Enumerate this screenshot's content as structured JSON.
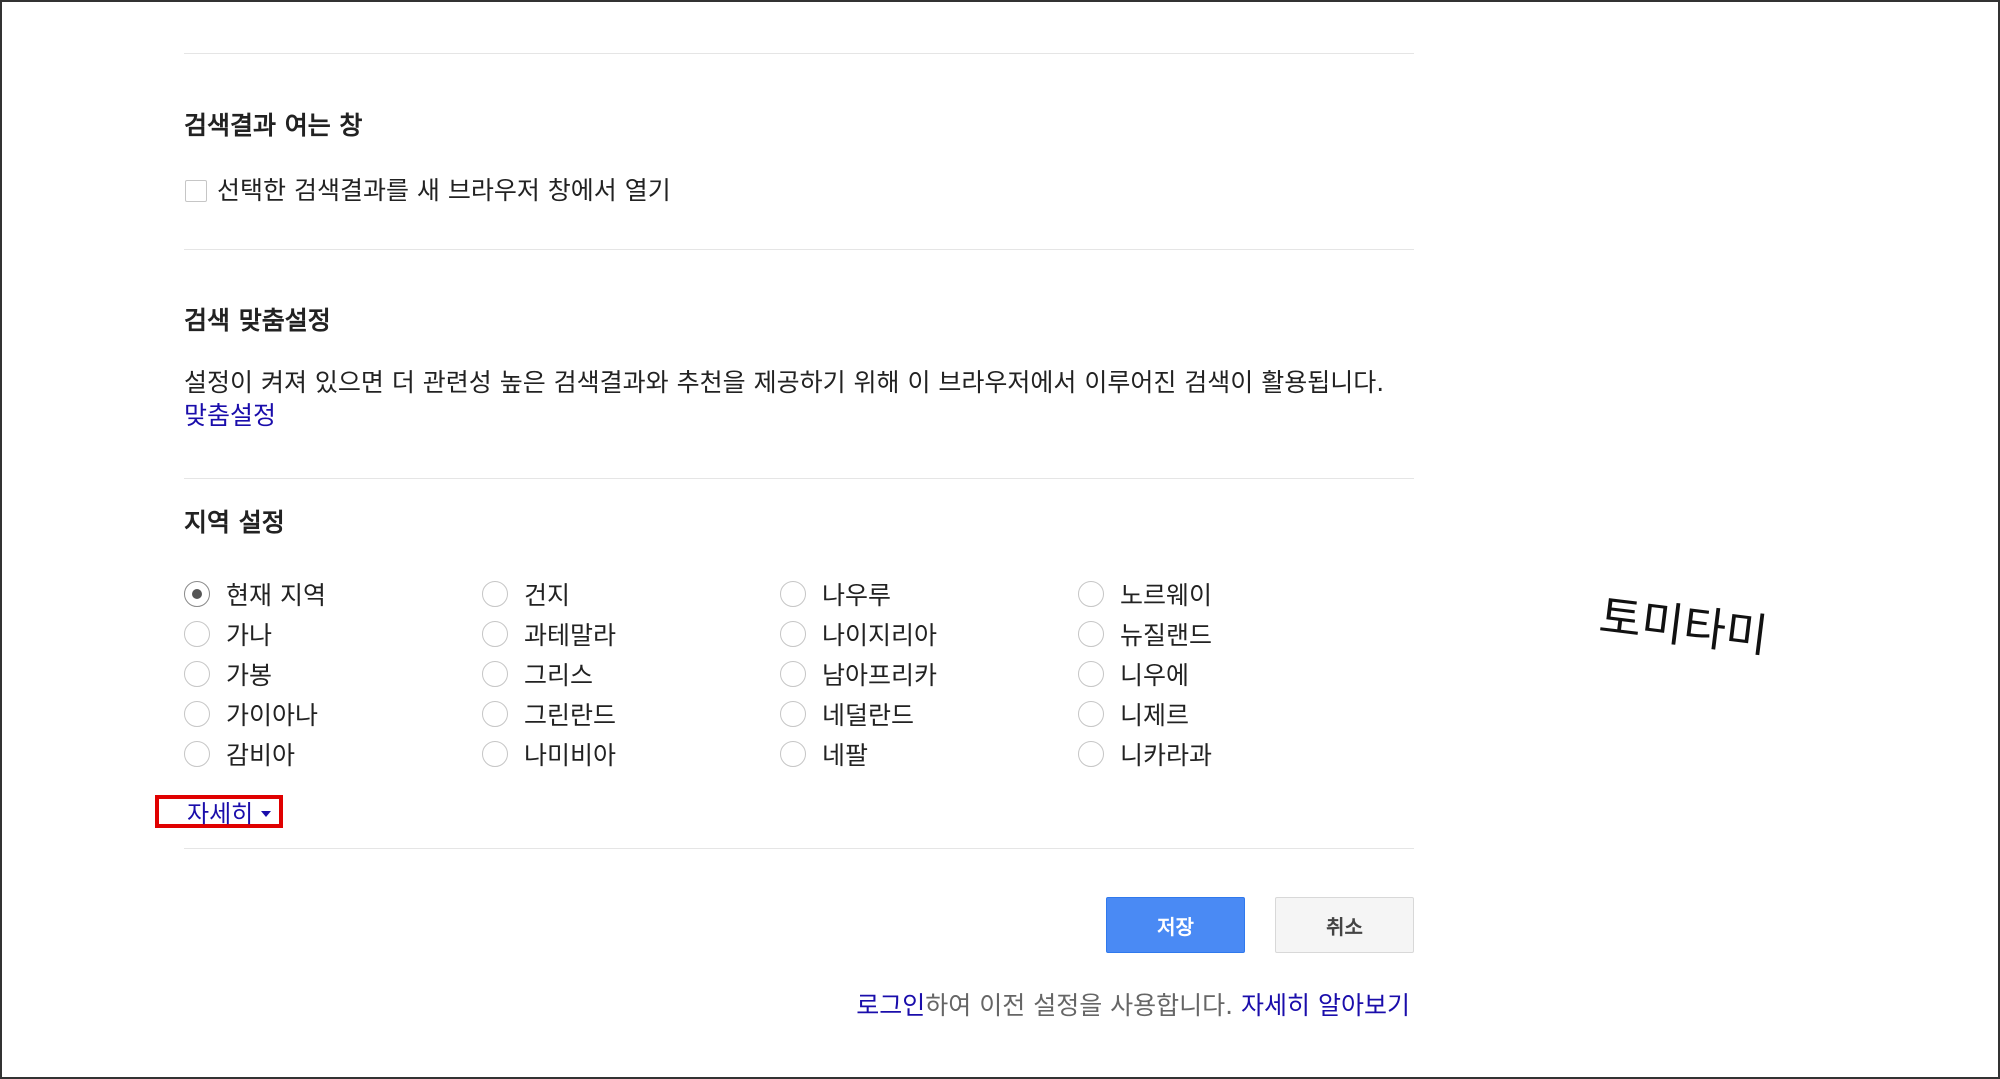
{
  "window_section": {
    "title": "검색결과 여는 창",
    "checkbox_label": "선택한 검색결과를 새 브라우저 창에서 열기",
    "checked": false
  },
  "personalization": {
    "title": "검색 맞춤설정",
    "description": "설정이 켜져 있으면 더 관련성 높은 검색결과와 추천을 제공하기 위해 이 브라우저에서 이루어진 검색이 활용됩니다.",
    "link_label": "맞춤설정"
  },
  "region": {
    "title": "지역 설정",
    "selected": "현재 지역",
    "columns": [
      [
        "현재 지역",
        "가나",
        "가봉",
        "가이아나",
        "감비아"
      ],
      [
        "건지",
        "과테말라",
        "그리스",
        "그린란드",
        "나미비아"
      ],
      [
        "나우루",
        "나이지리아",
        "남아프리카",
        "네덜란드",
        "네팔"
      ],
      [
        "노르웨이",
        "뉴질랜드",
        "니우에",
        "니제르",
        "니카라과"
      ]
    ],
    "more_label": "자세히"
  },
  "buttons": {
    "save_label": "저장",
    "cancel_label": "취소"
  },
  "footer": {
    "login_link": "로그인",
    "text": "하여 이전 설정을 사용합니다.",
    "learn_more_link": "자세히 알아보기"
  },
  "watermark": "토미타미",
  "colors": {
    "link": "#1a0dab",
    "save_button": "#4a8af4",
    "highlight_box": "#e00000"
  }
}
